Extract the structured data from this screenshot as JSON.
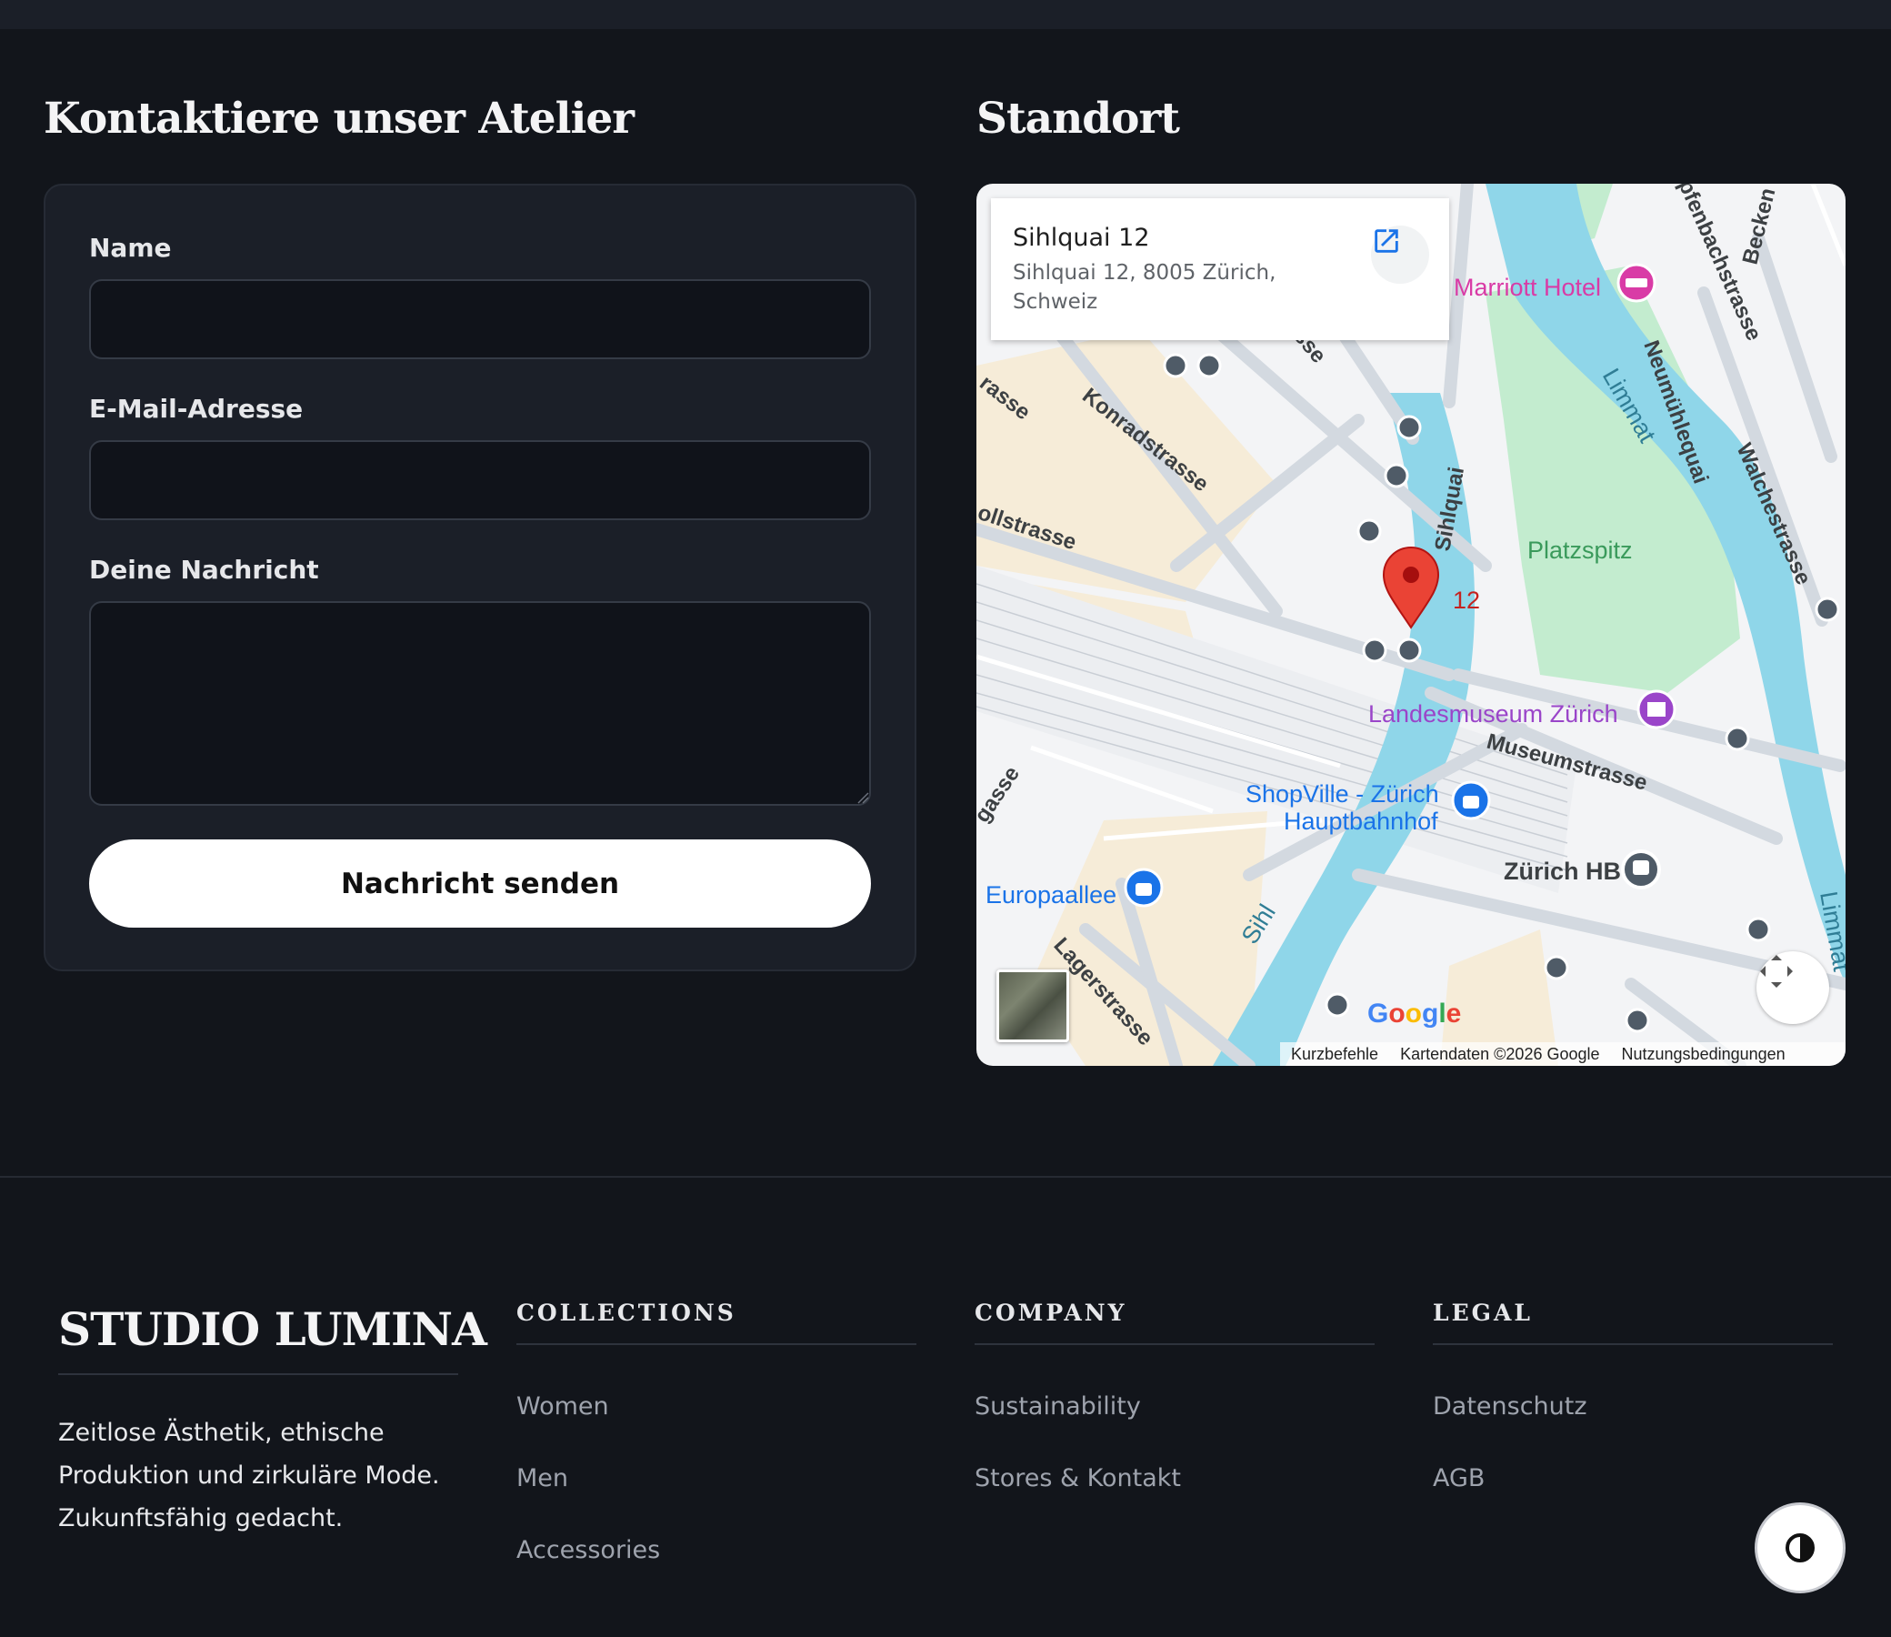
{
  "contact": {
    "heading": "Kontaktiere unser Atelier",
    "name_label": "Name",
    "email_label": "E-Mail-Adresse",
    "message_label": "Deine Nachricht",
    "name_value": "",
    "email_value": "",
    "message_value": "",
    "submit_label": "Nachricht senden"
  },
  "location": {
    "heading": "Standort",
    "place_title": "Sihlquai 12",
    "place_address": "Sihlquai 12, 8005 Zürich, Schweiz",
    "marker_label": "12",
    "map_labels": {
      "marriott": "Marriott Hotel",
      "limmat": "Limmat",
      "limmat_2": "Limmat",
      "neumuehlequai": "Neumühlequai",
      "walchestrasse": "Walchestrasse",
      "platzspitz": "Platzspitz",
      "sihlquai": "Sihlquai",
      "konradstrasse": "Konradstrasse",
      "zollstrasse": "ollstrasse",
      "trasse": "rasse",
      "landesmuseum": "Landesmuseum Zürich",
      "museumstrasse": "Museumstrasse",
      "shopville_1": "ShopVille - Zürich",
      "shopville_2": "Hauptbahnhof",
      "zuerich_hb": "Zürich HB",
      "europaallee": "Europaallee",
      "lagerstrasse": "Lagerstrasse",
      "sihl": "Sihl",
      "beckenhof": "Becken",
      "stampfenbach": "pfenbachstrasse",
      "gasse": "gasse",
      "sse": "sse"
    },
    "footer": {
      "shortcuts": "Kurzbefehle",
      "map_data": "Kartendaten ©2026 Google",
      "terms": "Nutzungsbedingungen"
    },
    "google_logo": "Google",
    "colors": {
      "water": "#8fd6e9",
      "park": "#c3eccf",
      "road": "#d3d9e0",
      "marker": "#ea4335",
      "poi_pink": "#d93ba6",
      "poi_purple": "#9a45c9",
      "poi_blue": "#1a73e8"
    }
  },
  "footer": {
    "brand": "STUDIO LUMINA",
    "tagline": "Zeitlose Ästhetik, ethische Produktion und zirkuläre Mode. Zukunftsfähig gedacht.",
    "columns": [
      {
        "heading": "COLLECTIONS",
        "links": [
          "Women",
          "Men",
          "Accessories"
        ]
      },
      {
        "heading": "COMPANY",
        "links": [
          "Sustainability",
          "Stores & Kontakt"
        ]
      },
      {
        "heading": "LEGAL",
        "links": [
          "Datenschutz",
          "AGB"
        ]
      }
    ]
  },
  "icons": {
    "external_link": "open-in-new-icon",
    "fullscreen": "fullscreen-icon",
    "theme_toggle": "contrast-icon",
    "map_pin": "map-pin-icon"
  }
}
